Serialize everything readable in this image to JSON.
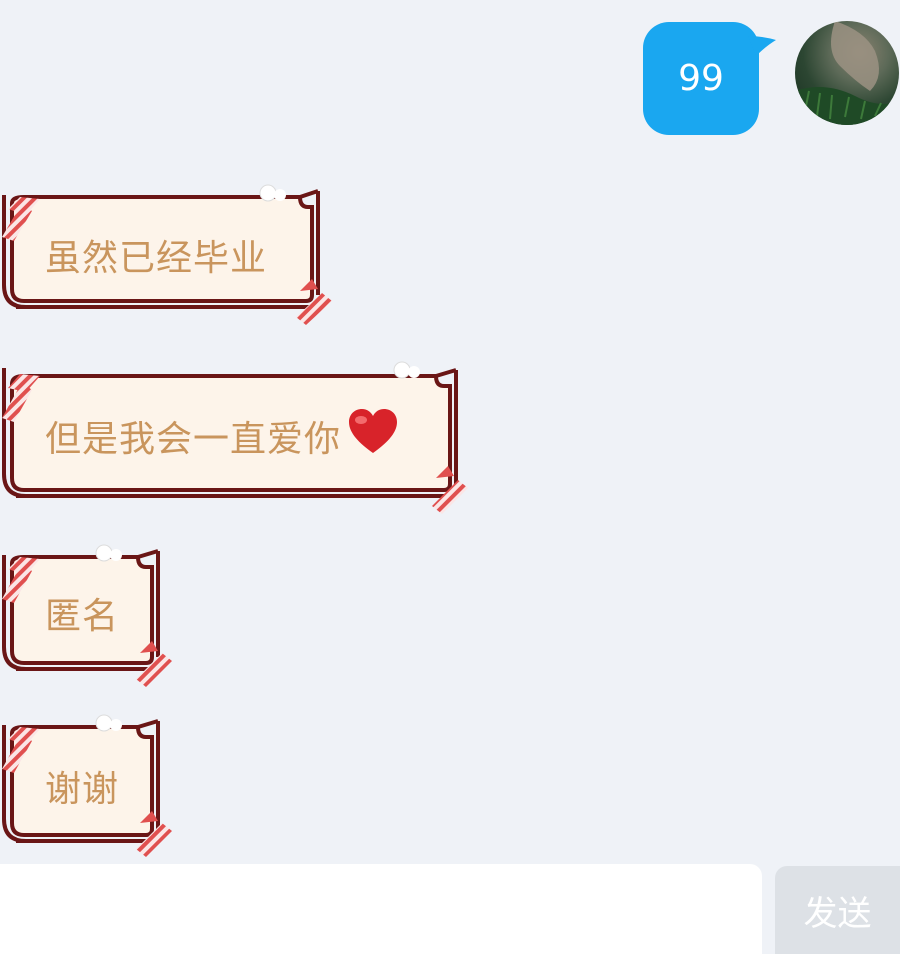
{
  "conversation": {
    "outgoing": [
      {
        "text": "99"
      }
    ],
    "incoming": [
      {
        "text": "虽然已经毕业"
      },
      {
        "text": "但是我会一直爱你",
        "emoji": "❤️"
      },
      {
        "text": "匿名"
      },
      {
        "text": "谢谢"
      }
    ]
  },
  "input": {
    "value": "",
    "placeholder": "",
    "send_label": "发送"
  },
  "colors": {
    "background": "#eff2f7",
    "outgoing_bubble": "#1aa7f0",
    "incoming_fill": "#fdf4ea",
    "incoming_border": "#6a1616",
    "incoming_text": "#c9955d",
    "scarf_red": "#e0504f",
    "send_button_bg": "#dde1e6"
  },
  "icons": {
    "bubble_style": "christmas-sleigh-scarf-bubble",
    "heart": "red-heart-emoji",
    "avatar": "user-avatar-photo"
  }
}
